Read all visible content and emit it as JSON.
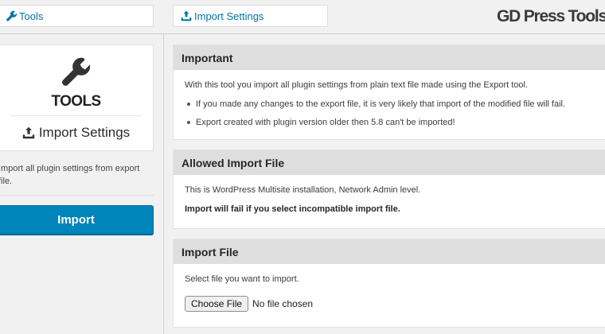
{
  "breadcrumb": {
    "tools_label": "Tools",
    "import_settings_label": "Import Settings"
  },
  "brand": {
    "title": "GD Press Tools"
  },
  "sidebar": {
    "title": "TOOLS",
    "subtitle": "Import Settings",
    "description": "Import all plugin settings from export file.",
    "import_button_label": "Import"
  },
  "panels": {
    "important": {
      "heading": "Important",
      "intro": "With this tool you import all plugin settings from plain text file made using the Export tool.",
      "bullets": [
        "If you made any changes to the export file, it is very likely that import of the modified file will fail.",
        "Export created with plugin version older then 5.8 can't be imported!"
      ]
    },
    "allowed": {
      "heading": "Allowed Import File",
      "line1": "This is WordPress Multisite installation, Network Admin level.",
      "line2": "Import will fail if you select incompatible import file."
    },
    "import_file": {
      "heading": "Import File",
      "prompt": "Select file you want to import.",
      "choose_button_label": "Choose File",
      "status": "No file chosen"
    }
  },
  "colors": {
    "accent": "#0085ba",
    "link": "#0073aa",
    "panel_header": "#dedede"
  },
  "icons": {
    "tools": "wrench-icon",
    "import": "upload-tray-icon"
  }
}
